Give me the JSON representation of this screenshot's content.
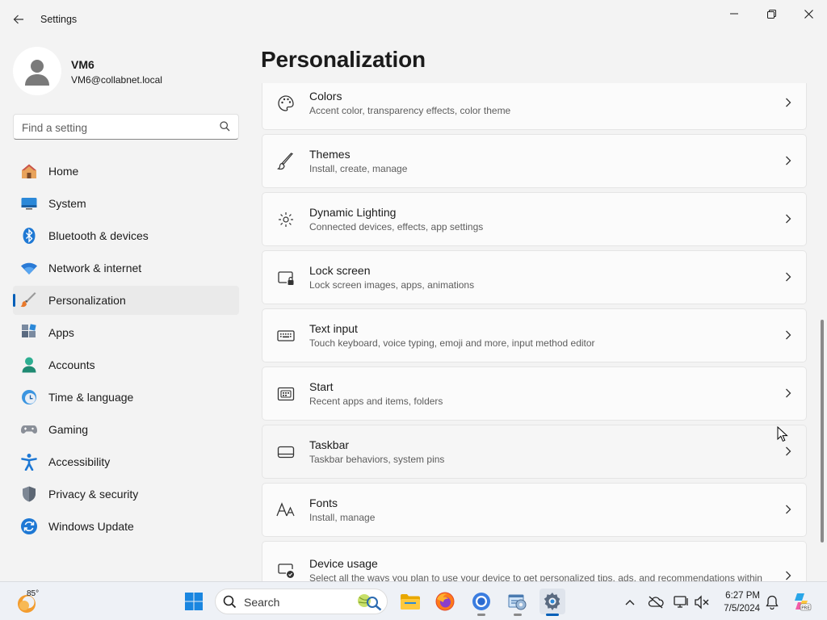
{
  "window": {
    "title": "Settings"
  },
  "profile": {
    "name": "VM6",
    "email": "VM6@collabnet.local"
  },
  "search": {
    "placeholder": "Find a setting"
  },
  "nav": {
    "items": [
      {
        "label": "Home",
        "icon": "home-icon"
      },
      {
        "label": "System",
        "icon": "monitor-icon"
      },
      {
        "label": "Bluetooth & devices",
        "icon": "bluetooth-icon"
      },
      {
        "label": "Network & internet",
        "icon": "wifi-icon"
      },
      {
        "label": "Personalization",
        "icon": "paintbrush-icon",
        "active": true
      },
      {
        "label": "Apps",
        "icon": "apps-icon"
      },
      {
        "label": "Accounts",
        "icon": "person-icon"
      },
      {
        "label": "Time & language",
        "icon": "clock-globe-icon"
      },
      {
        "label": "Gaming",
        "icon": "gamepad-icon"
      },
      {
        "label": "Accessibility",
        "icon": "accessibility-icon"
      },
      {
        "label": "Privacy & security",
        "icon": "shield-icon"
      },
      {
        "label": "Windows Update",
        "icon": "update-icon"
      }
    ]
  },
  "main": {
    "title": "Personalization",
    "cards": [
      {
        "title": "Colors",
        "subtitle": "Accent color, transparency effects, color theme",
        "icon": "palette-icon"
      },
      {
        "title": "Themes",
        "subtitle": "Install, create, manage",
        "icon": "brush-icon"
      },
      {
        "title": "Dynamic Lighting",
        "subtitle": "Connected devices, effects, app settings",
        "icon": "lighting-icon"
      },
      {
        "title": "Lock screen",
        "subtitle": "Lock screen images, apps, animations",
        "icon": "lock-screen-icon"
      },
      {
        "title": "Text input",
        "subtitle": "Touch keyboard, voice typing, emoji and more, input method editor",
        "icon": "keyboard-icon"
      },
      {
        "title": "Start",
        "subtitle": "Recent apps and items, folders",
        "icon": "start-icon"
      },
      {
        "title": "Taskbar",
        "subtitle": "Taskbar behaviors, system pins",
        "icon": "taskbar-icon"
      },
      {
        "title": "Fonts",
        "subtitle": "Install, manage",
        "icon": "fonts-icon"
      },
      {
        "title": "Device usage",
        "subtitle": "Select all the ways you plan to use your device to get personalized tips, ads, and recommendations within",
        "icon": "device-usage-icon"
      }
    ]
  },
  "taskbar": {
    "weather_temp": "85°",
    "search_label": "Search",
    "time": "6:27 PM",
    "date": "7/5/2024"
  },
  "colors": {
    "accent": "#005fb8"
  }
}
